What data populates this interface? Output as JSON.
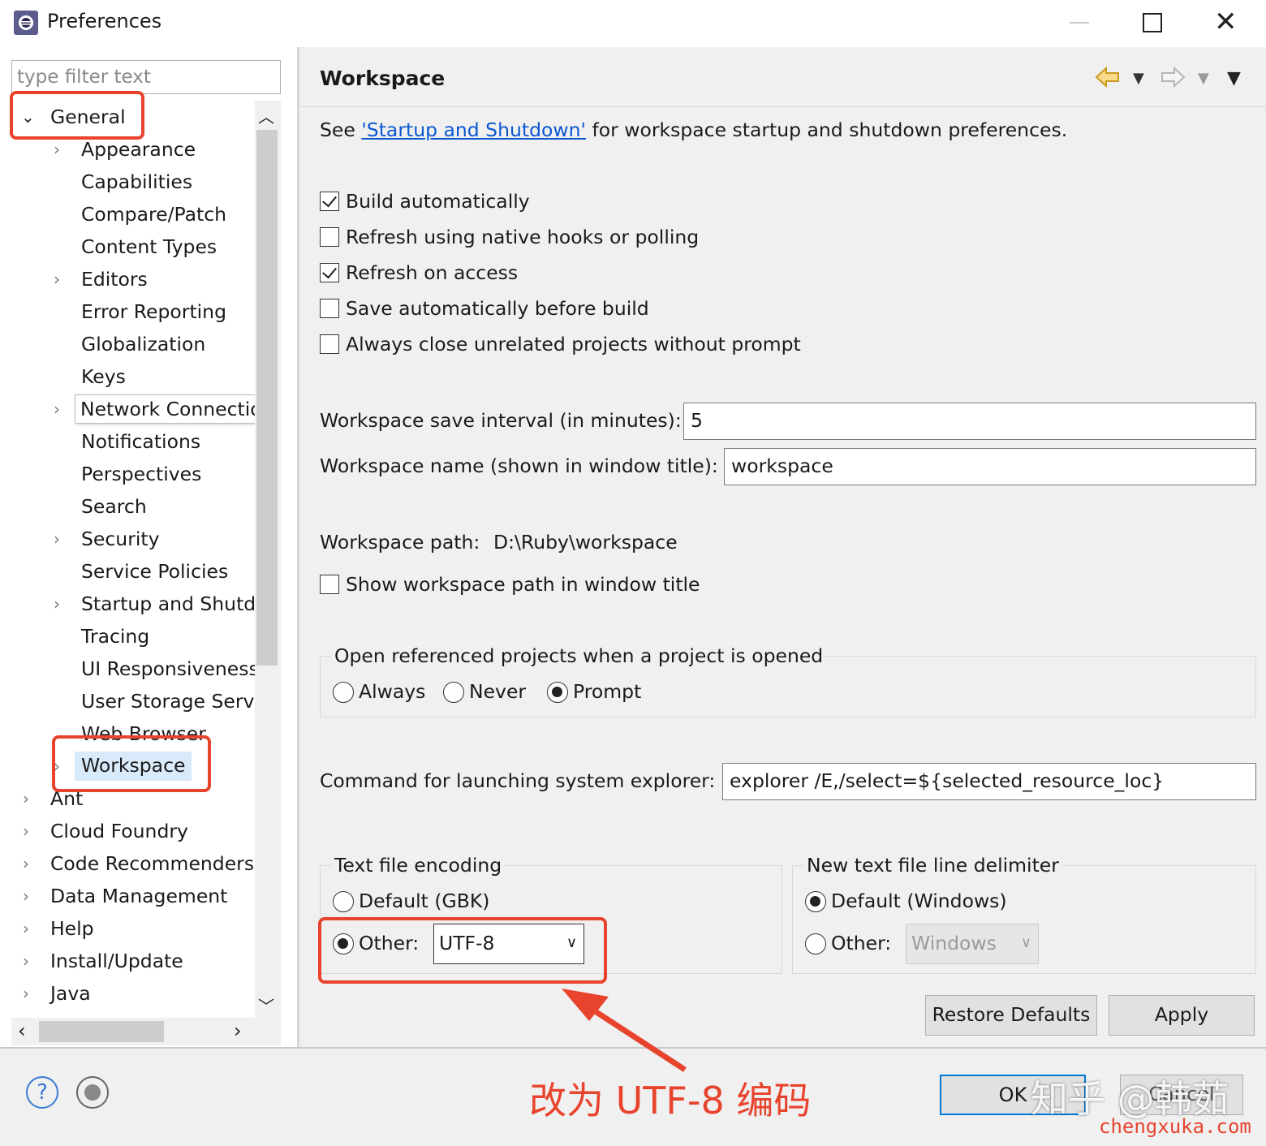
{
  "window": {
    "title": "Preferences"
  },
  "filter": {
    "placeholder": "type filter text"
  },
  "tree": {
    "general": "General",
    "general_children": [
      "Appearance",
      "Capabilities",
      "Compare/Patch",
      "Content Types",
      "Editors",
      "Error Reporting",
      "Globalization",
      "Keys",
      "Network Connections",
      "Notifications",
      "Perspectives",
      "Search",
      "Security",
      "Service Policies",
      "Startup and Shutd",
      "Tracing",
      "UI Responsiveness",
      "User Storage Serv",
      "Web Browser",
      "Workspace"
    ],
    "top_level": [
      "Ant",
      "Cloud Foundry",
      "Code Recommenders",
      "Data Management",
      "Help",
      "Install/Update",
      "Java"
    ],
    "selected": "Workspace"
  },
  "page": {
    "title": "Workspace",
    "see_prefix": "See",
    "see_link": "'Startup and Shutdown'",
    "see_suffix": "for workspace startup and shutdown preferences.",
    "checkboxes": [
      {
        "label": "Build automatically",
        "checked": true
      },
      {
        "label": "Refresh using native hooks or polling",
        "checked": false
      },
      {
        "label": "Refresh on access",
        "checked": true
      },
      {
        "label": "Save automatically before build",
        "checked": false
      },
      {
        "label": "Always close unrelated projects without prompt",
        "checked": false
      }
    ],
    "save_interval_label": "Workspace save interval (in minutes):",
    "save_interval_value": "5",
    "name_label": "Workspace name (shown in window title):",
    "name_value": "workspace",
    "path_label": "Workspace path:",
    "path_value": "D:\\Ruby\\workspace",
    "show_path_label": "Show workspace path in window title",
    "show_path_checked": false,
    "open_ref_title": "Open referenced projects when a project is opened",
    "open_ref_options": [
      "Always",
      "Never",
      "Prompt"
    ],
    "open_ref_selected": "Prompt",
    "explorer_label": "Command for launching system explorer:",
    "explorer_value": "explorer /E,/select=${selected_resource_loc}",
    "encoding": {
      "title": "Text file encoding",
      "default_label": "Default (GBK)",
      "other_label": "Other:",
      "other_value": "UTF-8",
      "selected": "Other"
    },
    "delimiter": {
      "title": "New text file line delimiter",
      "default_label": "Default (Windows)",
      "other_label": "Other:",
      "other_value": "Windows",
      "selected": "Default"
    },
    "restore_label": "Restore Defaults",
    "apply_label": "Apply"
  },
  "bottom": {
    "help_label": "?",
    "ok_label": "OK",
    "cancel_label": "Cancel"
  },
  "annotations": {
    "callout": "改为 UTF-8 编码",
    "watermark": "知乎 @韩茹",
    "site": "chengxuka.com",
    "color": "#e8432d"
  },
  "colors": {
    "link": "#0b57d0",
    "selection": "#d9ebfb",
    "focus_border": "#0078d7"
  }
}
